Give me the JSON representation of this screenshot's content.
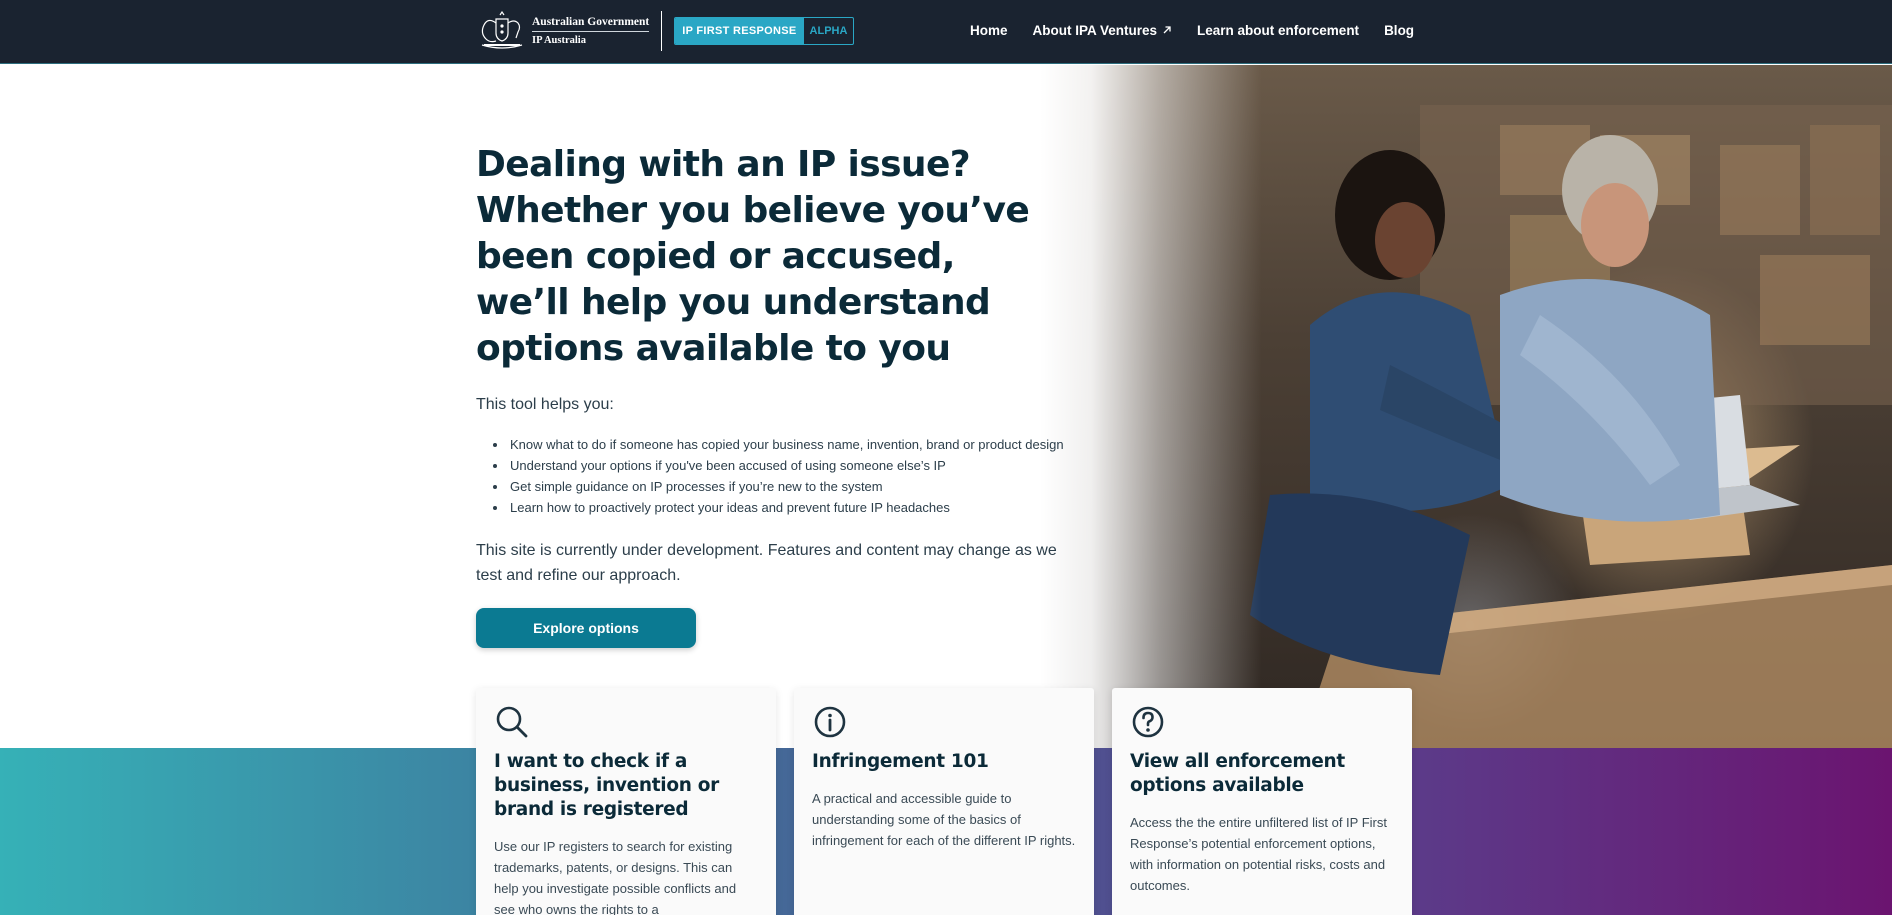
{
  "header": {
    "gov_line1": "Australian Government",
    "gov_line2": "IP Australia",
    "product_name": "IP FIRST RESPONSE",
    "product_stage": "ALPHA",
    "nav": [
      {
        "label": "Home"
      },
      {
        "label": "About IPA Ventures",
        "icon": "external-link-icon"
      },
      {
        "label": "Learn about enforcement"
      },
      {
        "label": "Blog"
      }
    ]
  },
  "hero": {
    "title": "Dealing with an IP issue? Whether you believe you’ve been copied or accused, we’ll help you understand options available to you",
    "intro": "This tool helps you:",
    "bullets": [
      "Know what to do if someone has copied your business name, invention, brand or product design",
      "Understand your options if you've been accused of using someone else’s IP",
      "Get simple guidance on IP processes if you’re new to the system",
      "Learn how to proactively protect your ideas and prevent future IP headaches"
    ],
    "notice": "This site is currently under development. Features and content may change as we test and refine our approach.",
    "cta_label": "Explore options"
  },
  "cards": [
    {
      "icon": "search-icon",
      "title": "I want to check if a business, invention or brand is registered",
      "body": "Use our IP registers to search for existing trademarks, patents, or designs. This can help you investigate possible conflicts and see who owns the rights to a"
    },
    {
      "icon": "info-icon",
      "title": "Infringement 101",
      "body": "A practical and accessible guide to understanding some of the basics of infringement for each of the different IP rights."
    },
    {
      "icon": "help-icon",
      "title": "View all enforcement options available",
      "body": "Access the the entire unfiltered list of IP First Response’s potential enforcement options, with information on potential risks, costs and outcomes."
    }
  ],
  "colors": {
    "header_bg": "#1a2330",
    "accent": "#2aa7c5",
    "cta": "#0b7a92",
    "heading": "#0b2a38",
    "band_start": "#36b1b7",
    "band_end": "#6b1470"
  }
}
